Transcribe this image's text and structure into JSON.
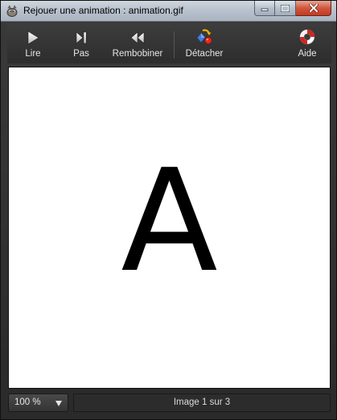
{
  "window": {
    "title": "Rejouer une animation :  animation.gif",
    "app_icon": "gimp-icon",
    "caption_buttons": [
      "minimize-icon",
      "maximize-icon",
      "close-icon"
    ]
  },
  "toolbar": {
    "play": {
      "label": "Lire",
      "icon": "play-icon"
    },
    "step": {
      "label": "Pas",
      "icon": "step-forward-icon"
    },
    "rewind": {
      "label": "Rembobiner",
      "icon": "rewind-icon"
    },
    "detach": {
      "label": "Détacher",
      "icon": "detach-icon"
    },
    "help": {
      "label": "Aide",
      "icon": "lifebuoy-icon"
    }
  },
  "canvas": {
    "frame_content": "A"
  },
  "statusbar": {
    "zoom": "100 %",
    "frame_info": "Image 1 sur 3"
  },
  "colors": {
    "toolbar_bg": "#333333",
    "canvas_bg": "#ffffff",
    "close_button": "#c94a30"
  }
}
